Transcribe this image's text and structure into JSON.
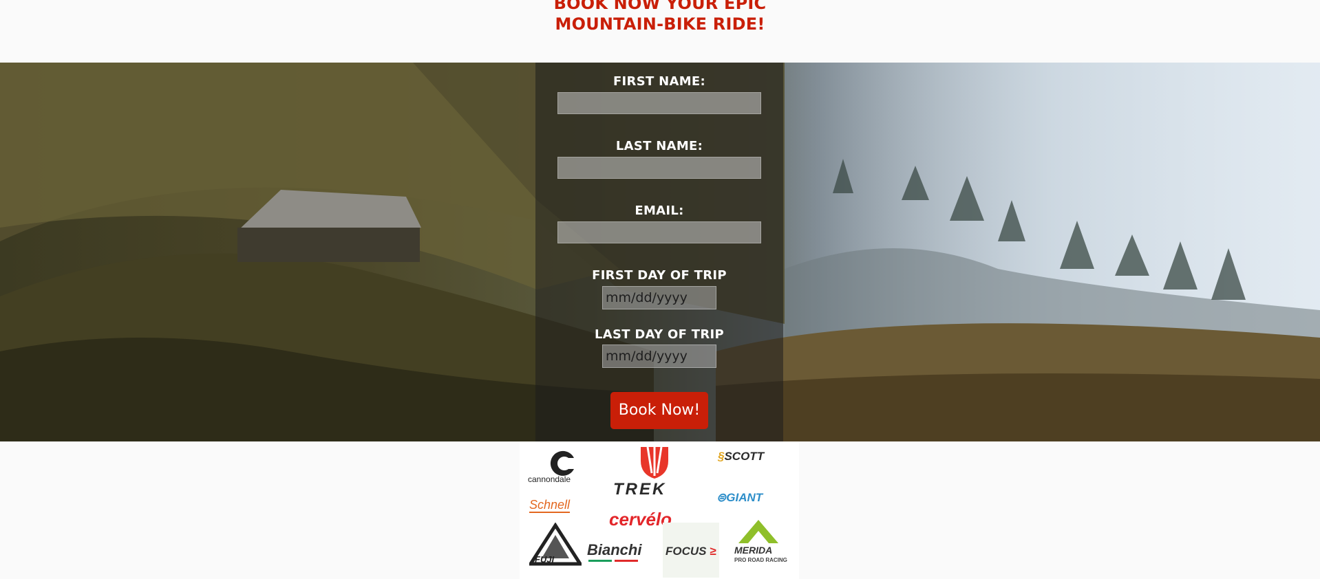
{
  "header": {
    "title_line1": "BOOK NOW YOUR EPIC",
    "title_line2": "MOUNTAIN-BIKE RIDE!"
  },
  "form": {
    "first_name_label": "FIRST NAME:",
    "last_name_label": "LAST NAME:",
    "email_label": "EMAIL:",
    "first_day_label": "FIRST DAY OF TRIP",
    "first_day_placeholder": "mm/dd/yyyy",
    "last_day_label": "LAST DAY OF TRIP",
    "last_day_placeholder": "mm/dd/yyyy",
    "submit_label": "Book Now!"
  },
  "brands": {
    "cannondale": "cannondale",
    "trek": "TREK",
    "scott": "SCOTT",
    "schnell": "Schnell",
    "giant": "GIANT",
    "cervelo": "cervélo",
    "fuji": "FUJI",
    "bianchi": "Bianchi",
    "focus": "FOCUS",
    "merida": "MERIDA",
    "merida_tagline": "PRO ROAD RACING"
  },
  "colors": {
    "accent": "#c91f08",
    "panel": "rgba(30,30,30,0.55)"
  }
}
